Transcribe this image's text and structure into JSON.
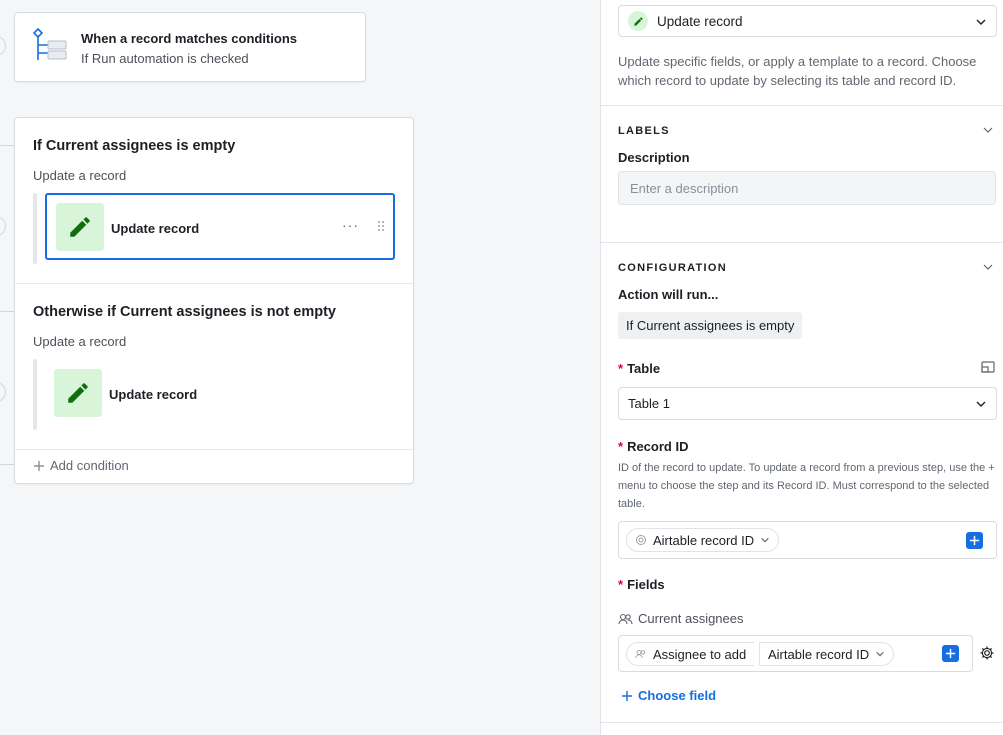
{
  "trigger": {
    "title": "When a record matches conditions",
    "subtitle": "If Run automation is checked",
    "icon": "trigger-flow-icon"
  },
  "condition_group": {
    "branches": [
      {
        "title": "If Current assignees is empty",
        "subtitle": "Update a record",
        "action_label": "Update record",
        "selected": true
      },
      {
        "title": "Otherwise if Current assignees is not empty",
        "subtitle": "Update a record",
        "action_label": "Update record",
        "selected": false
      }
    ],
    "more_glyph": "···",
    "add_condition_label": "Add condition"
  },
  "panel": {
    "action_select": {
      "label": "Update record"
    },
    "description": "Update specific fields, or apply a template to a record. Choose which record to update by selecting its table and record ID.",
    "labels_section": {
      "heading": "LABELS",
      "description_label": "Description",
      "description_placeholder": "Enter a description"
    },
    "configuration_section": {
      "heading": "CONFIGURATION",
      "action_will_run": "Action will run...",
      "condition_chip": "If Current assignees is empty",
      "table": {
        "required_mark": "*",
        "label": "Table",
        "value": "Table 1"
      },
      "record_id": {
        "required_mark": "*",
        "label": "Record ID",
        "help": "ID of the record to update. To update a record from a previous step, use the + menu to choose the step and its Record ID. Must correspond to the selected table.",
        "pill": "Airtable record ID"
      },
      "fields": {
        "required_mark": "*",
        "label": "Fields",
        "field_name": "Current assignees",
        "token_1": "Assignee to add",
        "token_2": "Airtable record ID",
        "choose_field_label": "Choose field"
      }
    }
  },
  "colors": {
    "accent": "#166ee1",
    "action_green": "#0f6e0f",
    "action_green_bg": "#d9f5d9",
    "required_red": "#dc043b"
  }
}
